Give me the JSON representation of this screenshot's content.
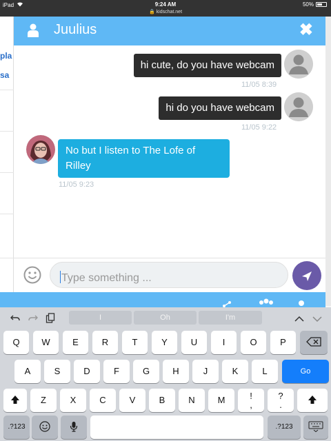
{
  "status_bar": {
    "device": "iPad",
    "time": "9:24 AM",
    "url": "kidschat.net",
    "battery": "50%",
    "battery_level": 0.5
  },
  "background_page": {
    "partial_texts": [
      "pla",
      "sa"
    ]
  },
  "chat": {
    "contact_name": "Juulius",
    "close_label": "✖",
    "messages": [
      {
        "from": "me",
        "text": "hi cute, do you have webcam",
        "time": "11/05 8:39"
      },
      {
        "from": "me",
        "text": "hi do you have webcam",
        "time": "11/05 9:22"
      },
      {
        "from": "them",
        "text": "No but I listen to The Lofe of Rilley",
        "time": "11/05 9:23"
      }
    ],
    "input": {
      "placeholder": "Type something ...",
      "value": ""
    }
  },
  "keyboard": {
    "suggestions": [
      "I",
      "Oh",
      "I'm"
    ],
    "row1": [
      "Q",
      "W",
      "E",
      "R",
      "T",
      "Y",
      "U",
      "I",
      "O",
      "P"
    ],
    "row2": [
      "A",
      "S",
      "D",
      "F",
      "G",
      "H",
      "J",
      "K",
      "L"
    ],
    "go_label": "Go",
    "row3": [
      "Z",
      "X",
      "C",
      "V",
      "B",
      "N",
      "M"
    ],
    "row3_punct": [
      "!\n,",
      "?\n."
    ],
    "numbers_label": ".?123",
    "colors": {
      "go": "#147efb",
      "header": "#5fb8f5",
      "send": "#6a5aa8",
      "their_bubble": "#1daee0",
      "my_bubble": "#2d2d2d"
    }
  }
}
